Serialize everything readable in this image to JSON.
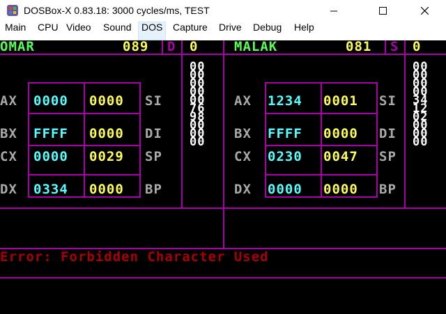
{
  "window": {
    "title": "DOSBox-X 0.83.18: 3000 cycles/ms, TEST",
    "controls": {
      "minimize": "minimize",
      "maximize": "maximize",
      "close": "close"
    }
  },
  "menu": [
    "Main",
    "CPU",
    "Video",
    "Sound",
    "DOS",
    "Capture",
    "Drive",
    "Debug",
    "Help"
  ],
  "active_menu": "DOS",
  "players": [
    {
      "name": "OMAR",
      "score": "089",
      "flag": "D",
      "flag_value": "0",
      "registers": {
        "AX": [
          "0000",
          "0000"
        ],
        "BX": [
          "FFFF",
          "0000"
        ],
        "CX": [
          "0000",
          "0029"
        ],
        "DX": [
          "0334",
          "0000"
        ]
      },
      "right_labels": [
        "SI",
        "DI",
        "SP",
        "BP"
      ],
      "memory": [
        "00",
        "00",
        "00",
        "00",
        "00",
        "76",
        "98",
        "00",
        "00",
        "00"
      ]
    },
    {
      "name": "MALAK",
      "score": "081",
      "flag": "S",
      "flag_value": "0",
      "registers": {
        "AX": [
          "1234",
          "0001"
        ],
        "BX": [
          "FFFF",
          "0000"
        ],
        "CX": [
          "0230",
          "0047"
        ],
        "DX": [
          "0000",
          "0000"
        ]
      },
      "right_labels": [
        "SI",
        "DI",
        "SP",
        "BP"
      ],
      "memory": [
        "00",
        "00",
        "00",
        "00",
        "34",
        "12",
        "02",
        "00",
        "00",
        "00"
      ]
    }
  ],
  "error_message": "Error: Forbidden Character Used",
  "colors": {
    "background": "#000000",
    "frame": "#aa00aa",
    "name": "#55ff55",
    "score": "#ffff55",
    "register_value": "#55ffff",
    "label": "#aaaaaa",
    "error": "#aa0000",
    "memory": "#ffffff"
  }
}
